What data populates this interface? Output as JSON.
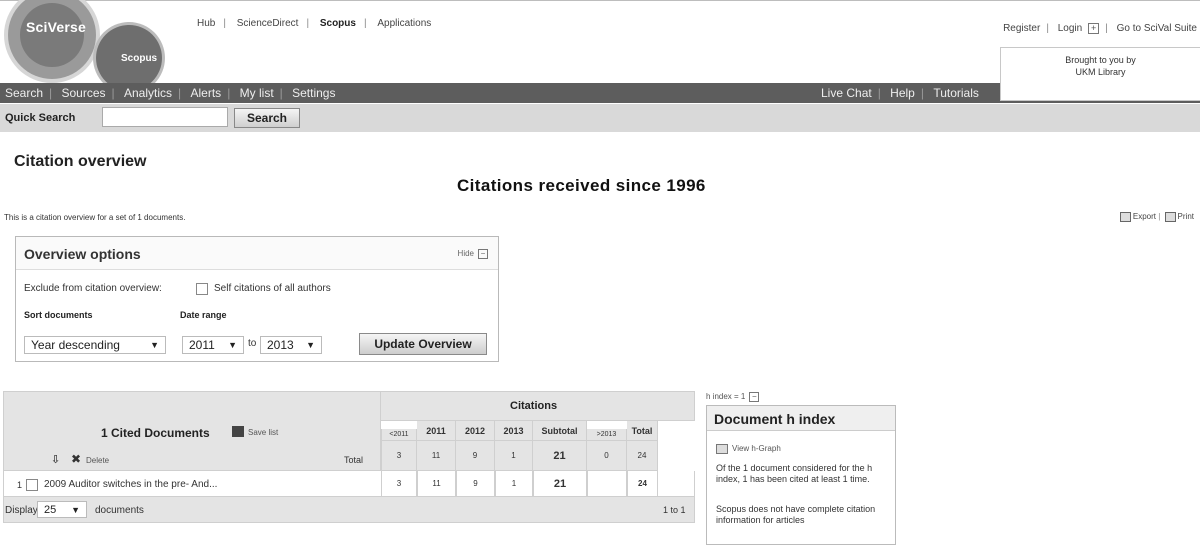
{
  "header": {
    "logo": {
      "brand": "SciVerse",
      "product": "Scopus"
    },
    "top_links": [
      "Hub",
      "ScienceDirect",
      "Scopus",
      "Applications"
    ],
    "right_links": {
      "register": "Register",
      "login": "Login",
      "goto": "Go to SciVal Suite"
    },
    "brought_by": {
      "line1": "Brought to you by",
      "line2": "UKM Library"
    }
  },
  "nav": {
    "left": [
      "Search",
      "Sources",
      "Analytics",
      "Alerts",
      "My list",
      "Settings"
    ],
    "right": [
      "Live Chat",
      "Help",
      "Tutorials"
    ]
  },
  "quick_search": {
    "label": "Quick Search",
    "value": "",
    "button": "Search"
  },
  "page": {
    "title": "Citation overview",
    "chart_title": "Citations received since 1996",
    "intro": "This is a citation overview for a set of 1 documents.",
    "export": "Export",
    "print": "Print"
  },
  "options": {
    "title": "Overview options",
    "hide": "Hide",
    "exclude_label": "Exclude from citation overview:",
    "self_citations": "Self citations of all authors",
    "sort_label": "Sort documents",
    "range_label": "Date range",
    "sort_value": "Year descending",
    "from_value": "2011",
    "to_text": "to",
    "to_value": "2013",
    "update_button": "Update Overview"
  },
  "citations_table": {
    "group_header": "Citations",
    "docs_header": "1 Cited Documents",
    "save_list": "Save list",
    "delete": "Delete",
    "total_label": "Total",
    "columns": [
      "<2011",
      "2011",
      "2012",
      "2013",
      "Subtotal",
      ">2013",
      "Total"
    ],
    "totals": [
      "3",
      "11",
      "9",
      "1",
      "21",
      "0",
      "24"
    ],
    "rows": [
      {
        "num": "1",
        "title": "2009  Auditor switches in the pre- And...",
        "values": [
          "3",
          "11",
          "9",
          "1",
          "21",
          "",
          "24"
        ]
      }
    ],
    "display_label": "Display",
    "display_value": "25",
    "documents_label": "documents",
    "pager": "1 to 1"
  },
  "h_index": {
    "small_label": "h index = 1",
    "title": "Document h index",
    "view_graph": "View h-Graph",
    "text1": "Of the 1 document considered for the h index, 1 has been cited at least 1 time.",
    "text2": "Scopus does not have complete citation information for articles"
  }
}
